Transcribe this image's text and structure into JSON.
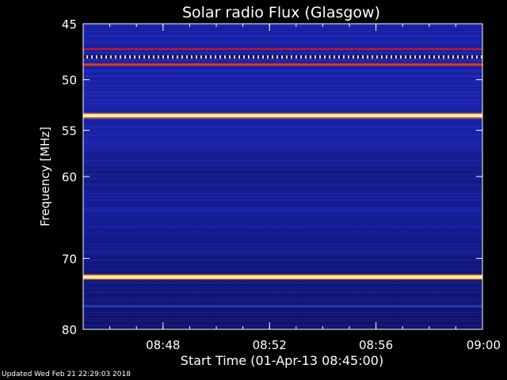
{
  "chart_data": {
    "type": "heatmap",
    "title": "Solar radio Flux (Glasgow)",
    "xlabel": "Start Time (01-Apr-13 08:45:00)",
    "ylabel": "Frequency [MHz]",
    "xlim": [
      "08:45",
      "09:00"
    ],
    "ylim": [
      45,
      80
    ],
    "y_scale": "log",
    "y_inverted": true,
    "x_ticks": [
      "08:48",
      "08:52",
      "08:56",
      "09:00"
    ],
    "y_ticks": [
      45,
      50,
      55,
      60,
      70,
      80
    ],
    "colormap": [
      "#0a0a2e",
      "#1a1aa0",
      "#2a3ae0",
      "#c01a10",
      "#ff6010",
      "#ffff80"
    ],
    "background_level": "blue",
    "bands": [
      {
        "freq_mhz": 47.2,
        "level": "red"
      },
      {
        "freq_mhz": 47.9,
        "level": "yellow-dotted"
      },
      {
        "freq_mhz": 48.6,
        "level": "red-orange"
      },
      {
        "freq_mhz": 53.5,
        "level": "bright-yellow"
      },
      {
        "freq_mhz": 72.5,
        "level": "bright-yellow"
      },
      {
        "freq_mhz": 76.6,
        "level": "light-blue"
      }
    ]
  },
  "footer": {
    "updated": "Updated Wed Feb 21 22:29:03 2018"
  }
}
